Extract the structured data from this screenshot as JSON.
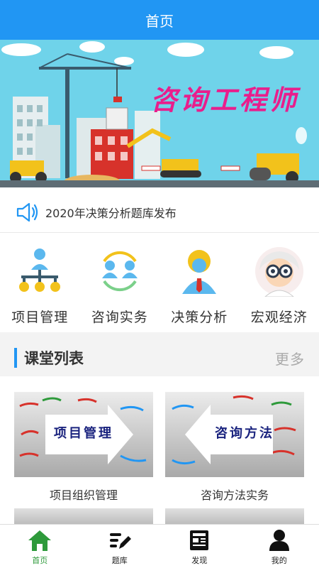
{
  "header": {
    "title": "首页"
  },
  "banner": {
    "title": "咨询工程师"
  },
  "notice": {
    "text": "2020年决策分析题库发布",
    "icon": "speaker-icon"
  },
  "categories": [
    {
      "label": "项目管理",
      "icon": "org-chart-icon"
    },
    {
      "label": "咨询实务",
      "icon": "people-exchange-icon"
    },
    {
      "label": "决策分析",
      "icon": "manager-icon"
    },
    {
      "label": "宏观经济",
      "icon": "scientist-icon"
    }
  ],
  "section": {
    "title": "课堂列表",
    "more": "更多"
  },
  "courses": [
    {
      "banner": "项目管理",
      "title": "项目组织管理"
    },
    {
      "banner": "咨询方法",
      "title": "咨询方法实务"
    }
  ],
  "tabs": [
    {
      "label": "首页",
      "icon": "home-icon",
      "active": true
    },
    {
      "label": "题库",
      "icon": "edit-list-icon",
      "active": false
    },
    {
      "label": "发现",
      "icon": "news-icon",
      "active": false
    },
    {
      "label": "我的",
      "icon": "user-icon",
      "active": false
    }
  ],
  "colors": {
    "primary": "#2196f3",
    "active_tab": "#2e9a3b",
    "banner_title": "#e91e8c"
  }
}
